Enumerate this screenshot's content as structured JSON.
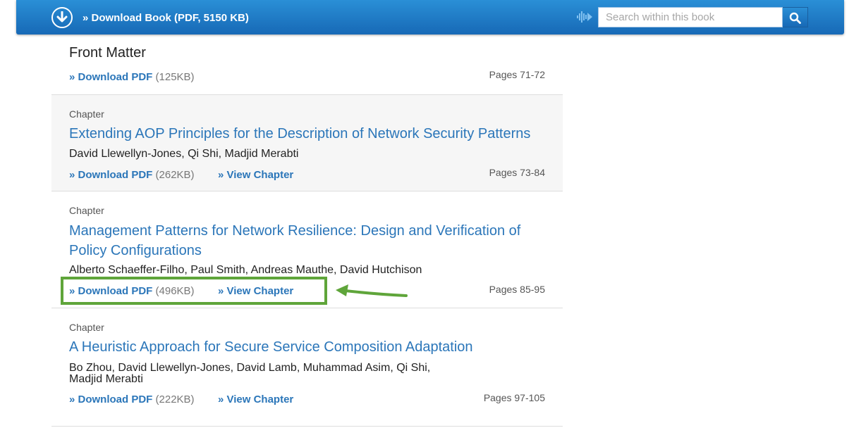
{
  "header": {
    "download_book_label": "» Download Book (PDF, 5150 KB)",
    "search_placeholder": "Search within this book"
  },
  "front_matter": {
    "title": "Front Matter",
    "download_label": "» Download PDF",
    "size": "(125KB)",
    "pages": "Pages 71-72"
  },
  "chapters": [
    {
      "label": "Chapter",
      "title": "Extending AOP Principles for the Description of Network Security Patterns",
      "authors": "David Llewellyn-Jones, Qi Shi, Madjid Merabti",
      "download_label": "» Download PDF",
      "size": "(262KB)",
      "view_label": "» View Chapter",
      "pages": "Pages 73-84"
    },
    {
      "label": "Chapter",
      "title": "Management Patterns for Network Resilience: Design and Verification of Policy Configurations",
      "authors": "Alberto Schaeffer-Filho, Paul Smith, Andreas Mauthe, David Hutchison",
      "download_label": "» Download PDF",
      "size": "(496KB)",
      "view_label": "» View Chapter",
      "pages": "Pages 85-95"
    },
    {
      "label": "Chapter",
      "title": "A Heuristic Approach for Secure Service Composition Adaptation",
      "authors": "Bo Zhou, David Llewellyn-Jones, David Lamb, Muhammad Asim, Qi Shi, Madjid Merabti",
      "download_label": "» Download PDF",
      "size": "(222KB)",
      "view_label": "» View Chapter",
      "pages": "Pages 97-105"
    }
  ],
  "colors": {
    "header_blue": "#1f7cc7",
    "link_blue": "#2b76b9",
    "highlight_green": "#5fa53a"
  }
}
